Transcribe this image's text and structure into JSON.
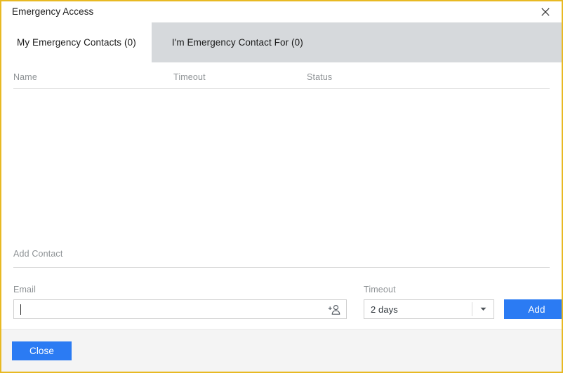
{
  "window": {
    "title": "Emergency Access",
    "border_color": "#e8b923",
    "close_icon": "close-icon"
  },
  "tabs": [
    {
      "label": "My Emergency Contacts (0)",
      "active": true
    },
    {
      "label": "I'm Emergency Contact For (0)",
      "active": false
    }
  ],
  "list": {
    "columns": [
      "Name",
      "Timeout",
      "Status"
    ],
    "rows": []
  },
  "add_contact": {
    "section_title": "Add Contact",
    "email": {
      "label": "Email",
      "value": "",
      "placeholder": "",
      "icon": "add-user-icon"
    },
    "timeout": {
      "label": "Timeout",
      "selected": "2 days",
      "icon": "chevron-down-icon"
    },
    "add_button": "Add"
  },
  "footer": {
    "close_button": "Close"
  },
  "colors": {
    "accent_blue": "#2b7bf3",
    "tabstrip_gray": "#d6d9dc",
    "muted_text": "#8e9295",
    "footer_gray": "#f4f4f4"
  }
}
